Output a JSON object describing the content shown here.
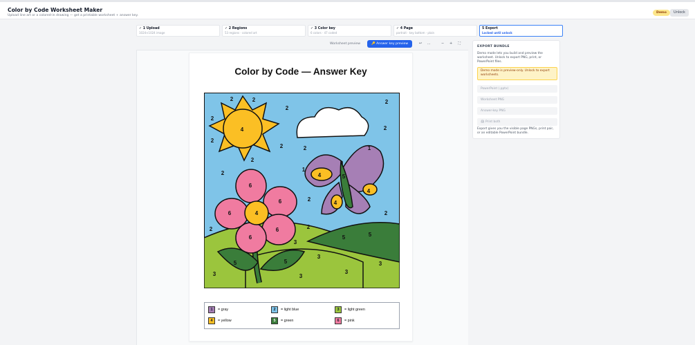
{
  "header": {
    "title": "Color by Code Worksheet Maker",
    "subtitle": "Upload line art or a colored-in drawing — get a printable worksheet + answer key.",
    "demo_badge": "Demo",
    "unlock_label": "Unlock"
  },
  "steps": [
    {
      "label": "✓ 1 Upload",
      "detail": "1024×1024 image"
    },
    {
      "label": "✓ 2 Regions",
      "detail": "53 regions · colored art"
    },
    {
      "label": "✓ 3 Color key",
      "detail": "6 colors · 47 coded"
    },
    {
      "label": "✓ 4 Page",
      "detail": "portrait · key bottom · plain"
    },
    {
      "label": "5 Export",
      "detail": "Locked until unlock"
    }
  ],
  "toolbar": {
    "worksheet_preview": "Worksheet preview",
    "answer_key_preview": "🔑 Answer key preview",
    "undo_icon": "↩",
    "zoom_out_dots": "…",
    "zoom_out": "−",
    "zoom_in": "+",
    "fit": "⛶"
  },
  "page": {
    "title": "Color by Code — Answer Key"
  },
  "artwork": {
    "numbers": [
      "1",
      "2",
      "3",
      "4",
      "5",
      "6"
    ]
  },
  "legend": [
    {
      "code": "1",
      "label": "= gray",
      "color": "#a67fb5"
    },
    {
      "code": "2",
      "label": "= light blue",
      "color": "#7fc4e8"
    },
    {
      "code": "3",
      "label": "= light green",
      "color": "#9bc53d"
    },
    {
      "code": "4",
      "label": "= yellow",
      "color": "#fbbf24"
    },
    {
      "code": "5",
      "label": "= green",
      "color": "#3a7d3a"
    },
    {
      "code": "6",
      "label": "= pink",
      "color": "#f07ba0"
    }
  ],
  "export_panel": {
    "heading": "EXPORT BUNDLE",
    "description": "Demo mode lets you build and preview the worksheet. Unlock to export PNG, print, or PowerPoint files.",
    "warning": "Demo mode is preview-only. Unlock to export worksheets.",
    "buttons": [
      "PowerPoint (.pptx)",
      "Worksheet PNG",
      "Answer-key PNG",
      "🖨 Print both"
    ],
    "footer": "Export gives you the visible page PNGs, print pair, or an editable PowerPoint bundle."
  },
  "colors": {
    "accent": "#2563eb",
    "sky": "#7fc4e8",
    "grass": "#9bc53d",
    "dark_green": "#3a7d3a",
    "yellow": "#fbbf24",
    "pink": "#f07ba0",
    "purple": "#a67fb5"
  }
}
